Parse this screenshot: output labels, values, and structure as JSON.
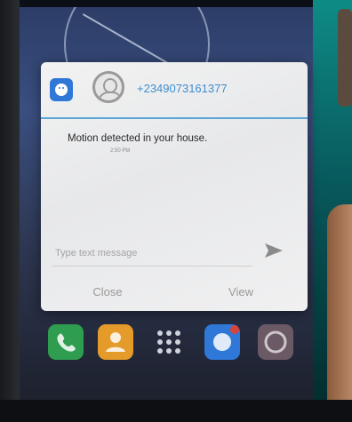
{
  "notification": {
    "sender": "+2349073161377",
    "message": "Motion detected in your house.",
    "time": "2:50 PM",
    "input_placeholder": "Type text message",
    "close_label": "Close",
    "view_label": "View"
  },
  "icons": {
    "app": "messaging-app-icon",
    "avatar": "contact-avatar-icon",
    "send": "send-arrow-icon",
    "dock": [
      "phone-icon",
      "contacts-icon",
      "apps-grid-icon",
      "messaging-icon",
      "browser-icon"
    ]
  },
  "colors": {
    "accent": "#3f8ed0",
    "divider": "#5aa6d6",
    "dialog_bg": "#eeeeee"
  }
}
